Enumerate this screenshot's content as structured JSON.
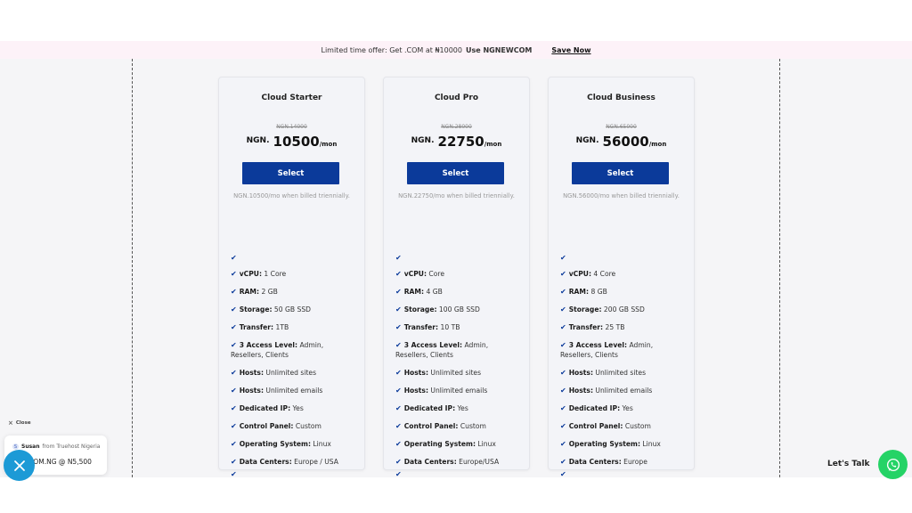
{
  "promo": {
    "prefix": "Limited time offer: Get .COM at ₦10000",
    "code_text": "Use NGNEWCOM",
    "link": "Save Now"
  },
  "plans": [
    {
      "name": "Cloud Starter",
      "old_price": "NGN.14000",
      "currency": "NGN.",
      "price": "10500",
      "per": "/mon",
      "button": "Select",
      "billed": "NGN.10500/mo when billed triennially.",
      "features": [
        {
          "label": "",
          "value": ""
        },
        {
          "label": "vCPU:",
          "value": " 1 Core"
        },
        {
          "label": "RAM:",
          "value": " 2 GB"
        },
        {
          "label": "Storage:",
          "value": " 50 GB SSD"
        },
        {
          "label": "Transfer:",
          "value": " 1TB"
        },
        {
          "label": "3 Access Level:",
          "value": " Admin, Resellers, Clients"
        },
        {
          "label": "Hosts:",
          "value": " Unlimited sites"
        },
        {
          "label": "Hosts:",
          "value": " Unlimited emails"
        },
        {
          "label": "Dedicated IP:",
          "value": " Yes"
        },
        {
          "label": "Control Panel:",
          "value": " Custom"
        },
        {
          "label": "Operating System:",
          "value": " Linux"
        },
        {
          "label": "Data Centers:",
          "value": " Europe / USA"
        },
        {
          "label": "",
          "value": ""
        }
      ]
    },
    {
      "name": "Cloud Pro",
      "old_price": "NGN.28000",
      "currency": "NGN.",
      "price": "22750",
      "per": "/mon",
      "button": "Select",
      "billed": "NGN.22750/mo when billed triennially.",
      "features": [
        {
          "label": "",
          "value": ""
        },
        {
          "label": "vCPU:",
          "value": " Core"
        },
        {
          "label": "RAM:",
          "value": " 4 GB"
        },
        {
          "label": "Storage:",
          "value": " 100 GB SSD"
        },
        {
          "label": "Transfer:",
          "value": " 10 TB"
        },
        {
          "label": "3 Access Level:",
          "value": " Admin, Resellers, Clients"
        },
        {
          "label": "Hosts:",
          "value": " Unlimited sites"
        },
        {
          "label": "Hosts:",
          "value": " Unlimited emails"
        },
        {
          "label": "Dedicated IP:",
          "value": " Yes"
        },
        {
          "label": "Control Panel:",
          "value": " Custom"
        },
        {
          "label": "Operating System:",
          "value": " Linux"
        },
        {
          "label": "Data Centers:",
          "value": " Europe/USA"
        },
        {
          "label": "",
          "value": ""
        }
      ]
    },
    {
      "name": "Cloud Business",
      "old_price": "NGN.65000",
      "currency": "NGN.",
      "price": "56000",
      "per": "/mon",
      "button": "Select",
      "billed": "NGN.56000/mo when billed triennially.",
      "features": [
        {
          "label": "",
          "value": ""
        },
        {
          "label": "vCPU:",
          "value": " 4 Core"
        },
        {
          "label": "RAM:",
          "value": " 8 GB"
        },
        {
          "label": "Storage:",
          "value": " 200 GB SSD"
        },
        {
          "label": "Transfer:",
          "value": " 25 TB"
        },
        {
          "label": "3 Access Level:",
          "value": " Admin, Resellers, Clients"
        },
        {
          "label": "Hosts:",
          "value": " Unlimited sites"
        },
        {
          "label": "Hosts:",
          "value": " Unlimited emails"
        },
        {
          "label": "Dedicated IP:",
          "value": " Yes"
        },
        {
          "label": "Control Panel:",
          "value": " Custom"
        },
        {
          "label": "Operating System:",
          "value": " Linux"
        },
        {
          "label": "Data Centers:",
          "value": " Europe"
        },
        {
          "label": "",
          "value": ""
        }
      ]
    }
  ],
  "notification": {
    "close_label": "Close",
    "avatar_initial": "S",
    "sender": "Susan",
    "sender_suffix": "from Truehost Nigeria",
    "message": "Get .COM.NG @ N5,500"
  },
  "chat": {
    "lets_talk": "Let's Talk"
  },
  "icons": {
    "check": "check-icon",
    "close": "close-icon",
    "whatsapp": "whatsapp-icon"
  },
  "colors": {
    "primary_button": "#0b3a9a",
    "promo_bg": "#fdf2f8",
    "whatsapp": "#25d366",
    "chat_fab": "#1c9ad6"
  }
}
